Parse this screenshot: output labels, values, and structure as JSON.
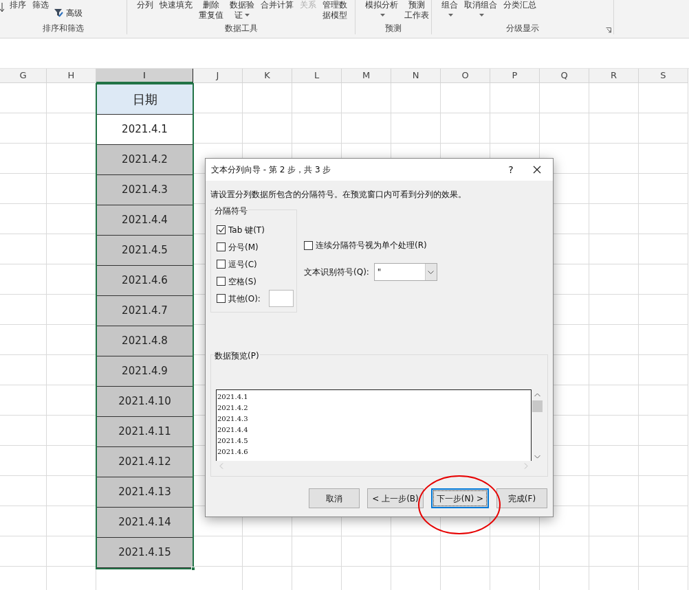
{
  "ribbon": {
    "groups": [
      {
        "label": "排序和筛选",
        "items": [
          {
            "lines": [
              "排序"
            ],
            "dropdown": false,
            "disabled": false
          },
          {
            "lines": [
              "筛选"
            ],
            "dropdown": false,
            "disabled": false
          },
          {
            "lines": [
              "高级"
            ],
            "dropdown": false,
            "disabled": false,
            "kind": "small"
          }
        ]
      },
      {
        "label": "数据工具",
        "items": [
          {
            "lines": [
              "分列"
            ],
            "dropdown": false,
            "disabled": false
          },
          {
            "lines": [
              "快速填充"
            ],
            "dropdown": false,
            "disabled": false
          },
          {
            "lines": [
              "删除",
              "重复值"
            ],
            "dropdown": false,
            "disabled": false
          },
          {
            "lines": [
              "数据验",
              "证"
            ],
            "dropdown": true,
            "disabled": false
          },
          {
            "lines": [
              "合并计算"
            ],
            "dropdown": false,
            "disabled": false
          },
          {
            "lines": [
              "关系"
            ],
            "dropdown": false,
            "disabled": true
          },
          {
            "lines": [
              "管理数",
              "据模型"
            ],
            "dropdown": false,
            "disabled": false
          }
        ]
      },
      {
        "label": "预测",
        "items": [
          {
            "lines": [
              "模拟分析"
            ],
            "dropdown": true,
            "disabled": false
          },
          {
            "lines": [
              "预测",
              "工作表"
            ],
            "dropdown": false,
            "disabled": false
          }
        ]
      },
      {
        "label": "分级显示",
        "items": [
          {
            "lines": [
              "组合"
            ],
            "dropdown": true,
            "disabled": false
          },
          {
            "lines": [
              "取消组合"
            ],
            "dropdown": true,
            "disabled": false
          },
          {
            "lines": [
              "分类汇总"
            ],
            "dropdown": false,
            "disabled": false
          }
        ],
        "launcher": true
      }
    ]
  },
  "sheet": {
    "columns": [
      {
        "label": "G",
        "selected": false
      },
      {
        "label": "H",
        "selected": false
      },
      {
        "label": "I",
        "selected": true
      },
      {
        "label": "J",
        "selected": false
      },
      {
        "label": "K",
        "selected": false
      },
      {
        "label": "L",
        "selected": false
      },
      {
        "label": "M",
        "selected": false
      },
      {
        "label": "N",
        "selected": false
      },
      {
        "label": "O",
        "selected": false
      },
      {
        "label": "P",
        "selected": false
      },
      {
        "label": "Q",
        "selected": false
      },
      {
        "label": "R",
        "selected": false
      },
      {
        "label": "S",
        "selected": false
      }
    ],
    "cells": [
      {
        "text": "日期",
        "kind": "header",
        "active": false
      },
      {
        "text": "2021.4.1",
        "kind": "value",
        "active": true
      },
      {
        "text": "2021.4.2",
        "kind": "value",
        "active": false
      },
      {
        "text": "2021.4.3",
        "kind": "value",
        "active": false
      },
      {
        "text": "2021.4.4",
        "kind": "value",
        "active": false
      },
      {
        "text": "2021.4.5",
        "kind": "value",
        "active": false
      },
      {
        "text": "2021.4.6",
        "kind": "value",
        "active": false
      },
      {
        "text": "2021.4.7",
        "kind": "value",
        "active": false
      },
      {
        "text": "2021.4.8",
        "kind": "value",
        "active": false
      },
      {
        "text": "2021.4.9",
        "kind": "value",
        "active": false
      },
      {
        "text": "2021.4.10",
        "kind": "value",
        "active": false
      },
      {
        "text": "2021.4.11",
        "kind": "value",
        "active": false
      },
      {
        "text": "2021.4.12",
        "kind": "value",
        "active": false
      },
      {
        "text": "2021.4.13",
        "kind": "value",
        "active": false
      },
      {
        "text": "2021.4.14",
        "kind": "value",
        "active": false
      },
      {
        "text": "2021.4.15",
        "kind": "value",
        "active": false
      }
    ]
  },
  "dialog": {
    "title": "文本分列向导 - 第 2 步，共 3 步",
    "help": "?",
    "instruction": "请设置分列数据所包含的分隔符号。在预览窗口内可看到分列的效果。",
    "delimiters": {
      "legend": "分隔符号",
      "options": [
        {
          "label": "Tab 键(T)",
          "checked": true
        },
        {
          "label": "分号(M)",
          "checked": false
        },
        {
          "label": "逗号(C)",
          "checked": false
        },
        {
          "label": "空格(S)",
          "checked": false
        },
        {
          "label": "其他(O):",
          "checked": false,
          "kind": "other"
        }
      ]
    },
    "consecutive": {
      "label": "连续分隔符号视为单个处理(R)",
      "checked": false
    },
    "qualifier": {
      "label": "文本识别符号(Q):",
      "value": "\""
    },
    "preview": {
      "legend": "数据预览(P)",
      "lines": [
        "2021.4.1",
        "2021.4.2",
        "2021.4.3",
        "2021.4.4",
        "2021.4.5",
        "2021.4.6"
      ]
    },
    "buttons": [
      {
        "label": "取消",
        "focused": false
      },
      {
        "label": "< 上一步(B)",
        "focused": false
      },
      {
        "label": "下一步(N) >",
        "focused": true
      },
      {
        "label": "完成(F)",
        "focused": false
      }
    ]
  },
  "annotation": {
    "kind": "circle"
  }
}
